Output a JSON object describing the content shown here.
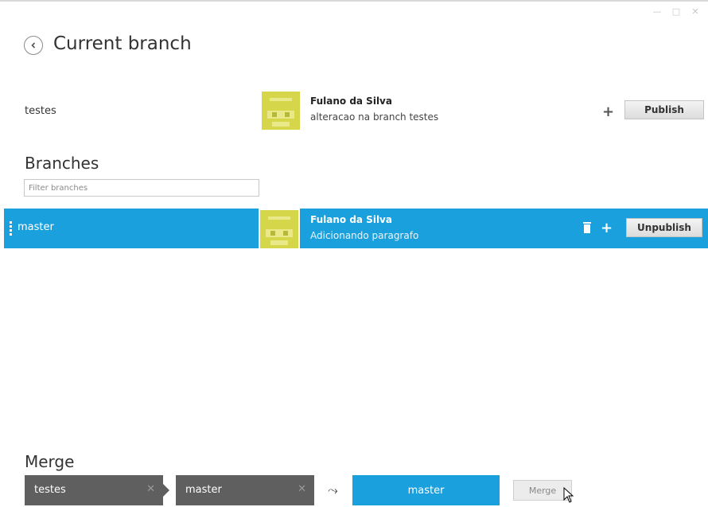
{
  "window": {
    "minimize": "—",
    "maximize": "□",
    "close": "✕"
  },
  "header": {
    "title": "Current branch"
  },
  "current_branch": {
    "name": "testes",
    "author": "Fulano da Silva",
    "message": "alteracao na branch testes",
    "add_label": "+",
    "publish_label": "Publish"
  },
  "branches": {
    "title": "Branches",
    "filter_placeholder": "Filter branches",
    "items": [
      {
        "name": "master",
        "author": "Fulano da Silva",
        "message": "Adicionando paragrafo",
        "add_label": "+",
        "unpublish_label": "Unpublish"
      }
    ]
  },
  "merge": {
    "title": "Merge",
    "source": "testes",
    "target": "master",
    "remove_label": "✕",
    "arrow": "⤳",
    "result": "master",
    "button_label": "Merge"
  },
  "colors": {
    "accent": "#1aa0dc",
    "avatar": "#d6d64a",
    "merge_box": "#5f5f5f"
  }
}
